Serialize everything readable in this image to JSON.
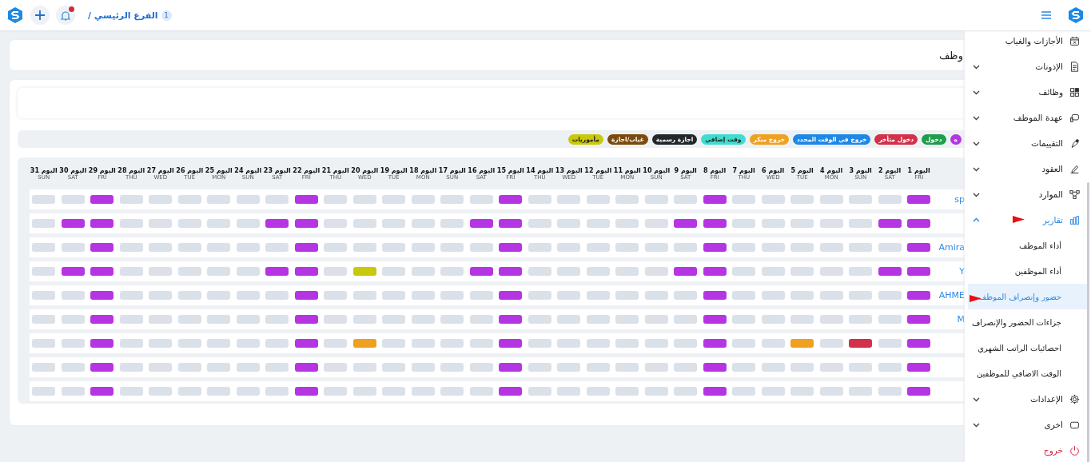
{
  "topbar": {
    "branch_count": "1",
    "branch": "الفرع الرئيسي /"
  },
  "page_title": "وظف",
  "legend": [
    {
      "kind": "holiday",
      "label": "ه",
      "color": "#b535e3"
    },
    {
      "kind": "in",
      "label": "دخول",
      "color": "#1f9d4c"
    },
    {
      "kind": "late",
      "label": "دخول متأخر",
      "color": "#d3304b"
    },
    {
      "kind": "out",
      "label": "خروج في الوقت المحدد",
      "color": "#1e88e5"
    },
    {
      "kind": "early",
      "label": "خروج مبكر",
      "color": "#f0a020"
    },
    {
      "kind": "overtime",
      "label": "وقت إضافي",
      "color": "#3fdcd0"
    },
    {
      "kind": "official",
      "label": "اجازة رسمية",
      "color": "#23262b"
    },
    {
      "kind": "absent",
      "label": "غياب/اجازة",
      "color": "#7b4a0c"
    },
    {
      "kind": "mission",
      "label": "مأموريات",
      "color": "#c9c80a"
    }
  ],
  "days": [
    {
      "label": "اليوم 1",
      "weekday": "FRI"
    },
    {
      "label": "اليوم 2",
      "weekday": "SAT"
    },
    {
      "label": "اليوم 3",
      "weekday": "SUN"
    },
    {
      "label": "اليوم 4",
      "weekday": "MON"
    },
    {
      "label": "اليوم 5",
      "weekday": "TUE"
    },
    {
      "label": "اليوم 6",
      "weekday": "WED"
    },
    {
      "label": "اليوم 7",
      "weekday": "THU"
    },
    {
      "label": "اليوم 8",
      "weekday": "FRI"
    },
    {
      "label": "اليوم 9",
      "weekday": "SAT"
    },
    {
      "label": "اليوم 10",
      "weekday": "SUN"
    },
    {
      "label": "اليوم 11",
      "weekday": "MON"
    },
    {
      "label": "اليوم 12",
      "weekday": "TUE"
    },
    {
      "label": "اليوم 13",
      "weekday": "WED"
    },
    {
      "label": "اليوم 14",
      "weekday": "THU"
    },
    {
      "label": "اليوم 15",
      "weekday": "FRI"
    },
    {
      "label": "اليوم 16",
      "weekday": "SAT"
    },
    {
      "label": "اليوم 17",
      "weekday": "SUN"
    },
    {
      "label": "اليوم 18",
      "weekday": "MON"
    },
    {
      "label": "اليوم 19",
      "weekday": "TUE"
    },
    {
      "label": "اليوم 20",
      "weekday": "WED"
    },
    {
      "label": "اليوم 21",
      "weekday": "THU"
    },
    {
      "label": "اليوم 22",
      "weekday": "FRI"
    },
    {
      "label": "اليوم 23",
      "weekday": "SAT"
    },
    {
      "label": "اليوم 24",
      "weekday": "SUN"
    },
    {
      "label": "اليوم 25",
      "weekday": "MON"
    },
    {
      "label": "اليوم 26",
      "weekday": "TUE"
    },
    {
      "label": "اليوم 27",
      "weekday": "WED"
    },
    {
      "label": "اليوم 28",
      "weekday": "THU"
    },
    {
      "label": "اليوم 29",
      "weekday": "FRI"
    },
    {
      "label": "اليوم 30",
      "weekday": "SAT"
    },
    {
      "label": "اليوم 31",
      "weekday": "SUN"
    }
  ],
  "rows": [
    {
      "name": "sp",
      "cells": [
        {
          "kind": "holiday"
        },
        {
          "kind": "none"
        },
        {
          "kind": "none"
        },
        {
          "kind": "none"
        },
        {
          "kind": "none"
        },
        {
          "kind": "none"
        },
        {
          "kind": "none"
        },
        {
          "kind": "holiday"
        },
        {
          "kind": "none"
        },
        {
          "kind": "none"
        },
        {
          "kind": "none"
        },
        {
          "kind": "none"
        },
        {
          "kind": "none"
        },
        {
          "kind": "none"
        },
        {
          "kind": "holiday"
        },
        {
          "kind": "none"
        },
        {
          "kind": "none"
        },
        {
          "kind": "none"
        },
        {
          "kind": "none"
        },
        {
          "kind": "none"
        },
        {
          "kind": "none"
        },
        {
          "kind": "holiday"
        },
        {
          "kind": "none"
        },
        {
          "kind": "none"
        },
        {
          "kind": "none"
        },
        {
          "kind": "none"
        },
        {
          "kind": "none"
        },
        {
          "kind": "none"
        },
        {
          "kind": "holiday"
        },
        {
          "kind": "none"
        },
        {
          "kind": "none"
        }
      ]
    },
    {
      "cells": [
        {
          "kind": "holiday"
        },
        {
          "kind": "holiday"
        },
        {
          "kind": "none"
        },
        {
          "kind": "none"
        },
        {
          "kind": "none"
        },
        {
          "kind": "none"
        },
        {
          "kind": "none"
        },
        {
          "kind": "holiday"
        },
        {
          "kind": "holiday"
        },
        {
          "kind": "none"
        },
        {
          "kind": "none"
        },
        {
          "kind": "none"
        },
        {
          "kind": "none"
        },
        {
          "kind": "none"
        },
        {
          "kind": "holiday"
        },
        {
          "kind": "holiday"
        },
        {
          "kind": "none"
        },
        {
          "kind": "none"
        },
        {
          "kind": "none"
        },
        {
          "kind": "none"
        },
        {
          "kind": "none"
        },
        {
          "kind": "holiday"
        },
        {
          "kind": "holiday"
        },
        {
          "kind": "none"
        },
        {
          "kind": "none"
        },
        {
          "kind": "none"
        },
        {
          "kind": "none"
        },
        {
          "kind": "none"
        },
        {
          "kind": "holiday"
        },
        {
          "kind": "holiday"
        },
        {
          "kind": "none"
        }
      ]
    },
    {
      "name": "Amira",
      "cells": [
        {
          "kind": "holiday"
        },
        {
          "kind": "none"
        },
        {
          "kind": "none"
        },
        {
          "kind": "none"
        },
        {
          "kind": "none"
        },
        {
          "kind": "none"
        },
        {
          "kind": "none"
        },
        {
          "kind": "holiday"
        },
        {
          "kind": "none"
        },
        {
          "kind": "none"
        },
        {
          "kind": "none"
        },
        {
          "kind": "none"
        },
        {
          "kind": "none"
        },
        {
          "kind": "none"
        },
        {
          "kind": "holiday"
        },
        {
          "kind": "none"
        },
        {
          "kind": "none"
        },
        {
          "kind": "none"
        },
        {
          "kind": "none"
        },
        {
          "kind": "none"
        },
        {
          "kind": "none"
        },
        {
          "kind": "holiday"
        },
        {
          "kind": "none"
        },
        {
          "kind": "none"
        },
        {
          "kind": "none"
        },
        {
          "kind": "none"
        },
        {
          "kind": "none"
        },
        {
          "kind": "none"
        },
        {
          "kind": "holiday"
        },
        {
          "kind": "none"
        },
        {
          "kind": "none"
        }
      ]
    },
    {
      "name": "Y",
      "cells": [
        {
          "kind": "holiday"
        },
        {
          "kind": "holiday"
        },
        {
          "kind": "none"
        },
        {
          "kind": "none"
        },
        {
          "kind": "none"
        },
        {
          "kind": "none"
        },
        {
          "kind": "none"
        },
        {
          "kind": "holiday"
        },
        {
          "kind": "holiday"
        },
        {
          "kind": "none"
        },
        {
          "kind": "none"
        },
        {
          "kind": "none"
        },
        {
          "kind": "none"
        },
        {
          "kind": "none"
        },
        {
          "kind": "holiday"
        },
        {
          "kind": "holiday"
        },
        {
          "kind": "none"
        },
        {
          "kind": "none"
        },
        {
          "kind": "none"
        },
        {
          "kind": "mission"
        },
        {
          "kind": "none"
        },
        {
          "kind": "holiday"
        },
        {
          "kind": "holiday"
        },
        {
          "kind": "none"
        },
        {
          "kind": "none"
        },
        {
          "kind": "none"
        },
        {
          "kind": "none"
        },
        {
          "kind": "none"
        },
        {
          "kind": "holiday"
        },
        {
          "kind": "holiday"
        },
        {
          "kind": "none"
        }
      ]
    },
    {
      "name": "AHME",
      "cells": [
        {
          "kind": "holiday"
        },
        {
          "kind": "none"
        },
        {
          "kind": "none"
        },
        {
          "kind": "none"
        },
        {
          "kind": "none"
        },
        {
          "kind": "none"
        },
        {
          "kind": "none"
        },
        {
          "kind": "holiday"
        },
        {
          "kind": "none"
        },
        {
          "kind": "none"
        },
        {
          "kind": "none"
        },
        {
          "kind": "none"
        },
        {
          "kind": "none"
        },
        {
          "kind": "none"
        },
        {
          "kind": "holiday"
        },
        {
          "kind": "none"
        },
        {
          "kind": "none"
        },
        {
          "kind": "none"
        },
        {
          "kind": "none"
        },
        {
          "kind": "none"
        },
        {
          "kind": "none"
        },
        {
          "kind": "holiday"
        },
        {
          "kind": "none"
        },
        {
          "kind": "none"
        },
        {
          "kind": "none"
        },
        {
          "kind": "none"
        },
        {
          "kind": "none"
        },
        {
          "kind": "none"
        },
        {
          "kind": "holiday"
        },
        {
          "kind": "none"
        },
        {
          "kind": "none"
        }
      ]
    },
    {
      "name": "M",
      "cells": [
        {
          "kind": "holiday"
        },
        {
          "kind": "none"
        },
        {
          "kind": "none"
        },
        {
          "kind": "none"
        },
        {
          "kind": "none"
        },
        {
          "kind": "none"
        },
        {
          "kind": "none"
        },
        {
          "kind": "holiday"
        },
        {
          "kind": "none"
        },
        {
          "kind": "none"
        },
        {
          "kind": "none"
        },
        {
          "kind": "none"
        },
        {
          "kind": "none"
        },
        {
          "kind": "none"
        },
        {
          "kind": "holiday"
        },
        {
          "kind": "none"
        },
        {
          "kind": "none"
        },
        {
          "kind": "none"
        },
        {
          "kind": "none"
        },
        {
          "kind": "none"
        },
        {
          "kind": "none"
        },
        {
          "kind": "holiday"
        },
        {
          "kind": "none"
        },
        {
          "kind": "none"
        },
        {
          "kind": "none"
        },
        {
          "kind": "none"
        },
        {
          "kind": "none"
        },
        {
          "kind": "none"
        },
        {
          "kind": "holiday"
        },
        {
          "kind": "none"
        },
        {
          "kind": "none"
        }
      ]
    },
    {
      "cells": [
        {
          "kind": "holiday"
        },
        {
          "kind": "none"
        },
        {
          "kind": "late"
        },
        {
          "kind": "none"
        },
        {
          "kind": "early"
        },
        {
          "kind": "none"
        },
        {
          "kind": "none"
        },
        {
          "kind": "holiday"
        },
        {
          "kind": "none"
        },
        {
          "kind": "none"
        },
        {
          "kind": "none"
        },
        {
          "kind": "none"
        },
        {
          "kind": "none"
        },
        {
          "kind": "none"
        },
        {
          "kind": "holiday"
        },
        {
          "kind": "none"
        },
        {
          "kind": "none"
        },
        {
          "kind": "none"
        },
        {
          "kind": "none"
        },
        {
          "kind": "early"
        },
        {
          "kind": "none"
        },
        {
          "kind": "holiday"
        },
        {
          "kind": "none"
        },
        {
          "kind": "none"
        },
        {
          "kind": "none"
        },
        {
          "kind": "none"
        },
        {
          "kind": "none"
        },
        {
          "kind": "none"
        },
        {
          "kind": "holiday"
        },
        {
          "kind": "none"
        },
        {
          "kind": "none"
        }
      ]
    },
    {
      "cells": [
        {
          "kind": "holiday"
        },
        {
          "kind": "none"
        },
        {
          "kind": "none"
        },
        {
          "kind": "none"
        },
        {
          "kind": "none"
        },
        {
          "kind": "none"
        },
        {
          "kind": "none"
        },
        {
          "kind": "holiday"
        },
        {
          "kind": "none"
        },
        {
          "kind": "none"
        },
        {
          "kind": "none"
        },
        {
          "kind": "none"
        },
        {
          "kind": "none"
        },
        {
          "kind": "none"
        },
        {
          "kind": "holiday"
        },
        {
          "kind": "none"
        },
        {
          "kind": "none"
        },
        {
          "kind": "none"
        },
        {
          "kind": "none"
        },
        {
          "kind": "none"
        },
        {
          "kind": "none"
        },
        {
          "kind": "holiday"
        },
        {
          "kind": "none"
        },
        {
          "kind": "none"
        },
        {
          "kind": "none"
        },
        {
          "kind": "none"
        },
        {
          "kind": "none"
        },
        {
          "kind": "none"
        },
        {
          "kind": "holiday"
        },
        {
          "kind": "none"
        },
        {
          "kind": "none"
        }
      ]
    },
    {
      "cells": [
        {
          "kind": "holiday"
        },
        {
          "kind": "none"
        },
        {
          "kind": "none"
        },
        {
          "kind": "none"
        },
        {
          "kind": "none"
        },
        {
          "kind": "none"
        },
        {
          "kind": "none"
        },
        {
          "kind": "holiday"
        },
        {
          "kind": "none"
        },
        {
          "kind": "none"
        },
        {
          "kind": "none"
        },
        {
          "kind": "none"
        },
        {
          "kind": "none"
        },
        {
          "kind": "none"
        },
        {
          "kind": "holiday"
        },
        {
          "kind": "none"
        },
        {
          "kind": "none"
        },
        {
          "kind": "none"
        },
        {
          "kind": "none"
        },
        {
          "kind": "none"
        },
        {
          "kind": "none"
        },
        {
          "kind": "holiday"
        },
        {
          "kind": "none"
        },
        {
          "kind": "none"
        },
        {
          "kind": "none"
        },
        {
          "kind": "none"
        },
        {
          "kind": "none"
        },
        {
          "kind": "none"
        },
        {
          "kind": "holiday"
        },
        {
          "kind": "none"
        },
        {
          "kind": "none"
        }
      ]
    }
  ],
  "sidebar": {
    "items": [
      {
        "kind": "plain",
        "label": "الأجازات والغياب"
      },
      {
        "kind": "group",
        "label": "الإذونات",
        "expanded": false
      },
      {
        "kind": "group",
        "label": "وظائف",
        "expanded": false
      },
      {
        "kind": "group",
        "label": "عهدة الموظف",
        "expanded": false
      },
      {
        "kind": "group",
        "label": "التقييمات",
        "expanded": false
      },
      {
        "kind": "group",
        "label": "العقود",
        "expanded": false
      },
      {
        "kind": "group",
        "label": "الموارد",
        "expanded": false
      },
      {
        "kind": "group",
        "label": "تقارير",
        "expanded": true,
        "pointer": true,
        "children": [
          {
            "label": "أداء الموظف",
            "selected": false,
            "pointer": false
          },
          {
            "label": "أداء الموظفين",
            "selected": false,
            "pointer": false
          },
          {
            "label": "حضور وإنصراف الموظف",
            "selected": true,
            "pointer": true
          },
          {
            "label": "جزاءات الحضور والإنصراف",
            "selected": false,
            "pointer": false
          },
          {
            "label": "احصائيات الراتب الشهري",
            "selected": false,
            "pointer": false
          },
          {
            "label": "الوقت الاضافي للموظفين",
            "selected": false,
            "pointer": false
          }
        ]
      },
      {
        "kind": "group",
        "label": "الإعدادات",
        "expanded": false
      },
      {
        "kind": "group",
        "label": "اخرى",
        "expanded": false
      },
      {
        "kind": "logout",
        "label": "خروج"
      }
    ]
  }
}
